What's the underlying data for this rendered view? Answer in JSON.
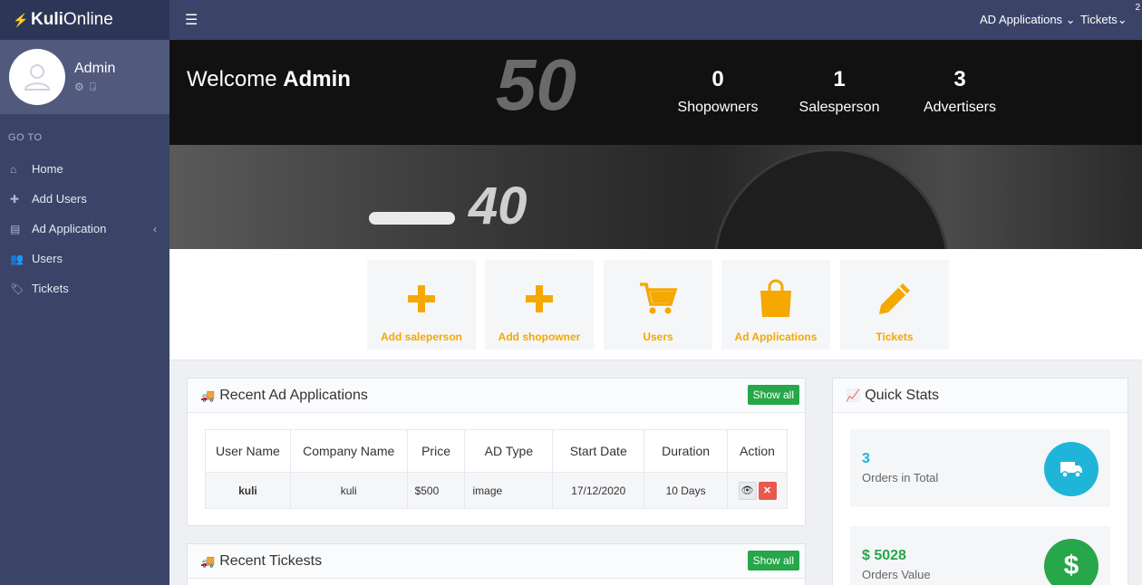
{
  "brand": {
    "bold": "Kuli",
    "rest": "Online"
  },
  "profile": {
    "name": "Admin"
  },
  "sidebar": {
    "section_label": "GO TO",
    "items": [
      {
        "label": "Home",
        "icon": "home-icon"
      },
      {
        "label": "Add Users",
        "icon": "plus-icon"
      },
      {
        "label": "Ad Application",
        "icon": "list-icon"
      },
      {
        "label": "Users",
        "icon": "users-icon"
      },
      {
        "label": "Tickets",
        "icon": "tag-icon"
      }
    ]
  },
  "topbar": {
    "ad_applications": "AD Applications",
    "tickets": "Tickets",
    "tickets_badge": "2"
  },
  "hero": {
    "welcome_prefix": "Welcome",
    "welcome_name": "Admin",
    "gauge_label_top": "50",
    "gauge_label_bottom": "40",
    "stats": [
      {
        "value": "0",
        "label": "Shopowners"
      },
      {
        "value": "1",
        "label": "Salesperson"
      },
      {
        "value": "3",
        "label": "Advertisers"
      }
    ]
  },
  "shortcuts": [
    {
      "label": "Add saleperson",
      "icon": "plus-icon"
    },
    {
      "label": "Add shopowner",
      "icon": "plus-icon"
    },
    {
      "label": "Users",
      "icon": "cart-icon"
    },
    {
      "label": "Ad Applications",
      "icon": "shopping-bag-icon"
    },
    {
      "label": "Tickets",
      "icon": "pencil-icon"
    }
  ],
  "recent_ads": {
    "title": "Recent Ad Applications",
    "show_all": "Show all",
    "columns": [
      "User Name",
      "Company Name",
      "Price",
      "AD Type",
      "Start Date",
      "Duration",
      "Action"
    ],
    "rows": [
      {
        "user": "kuli",
        "company": "kuli",
        "price": "$500",
        "type": "image",
        "start": "17/12/2020",
        "duration": "10 Days"
      }
    ]
  },
  "recent_tickets": {
    "title": "Recent Tickests",
    "show_all": "Show all"
  },
  "quick_stats": {
    "title": "Quick Stats",
    "items": [
      {
        "value": "3",
        "label": "Orders in Total",
        "color": "#1fb5d9",
        "icon": "truck-icon"
      },
      {
        "value": "$ 5028",
        "label": "Orders Value",
        "color": "#27a64a",
        "icon": "dollar-icon"
      }
    ]
  },
  "colors": {
    "sidebar": "#3b4468",
    "accent": "#f5a800",
    "success": "#27a64a",
    "info": "#1fb5d9"
  }
}
